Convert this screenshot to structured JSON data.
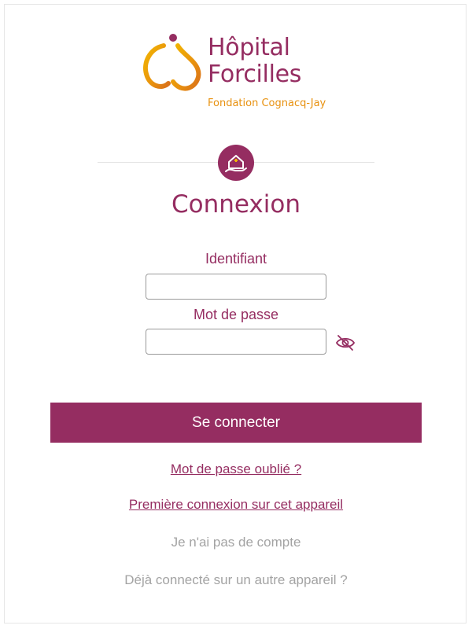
{
  "brand": {
    "name_line1": "Hôpital",
    "name_line2": "Forcilles",
    "subtitle": "Fondation Cognacq-Jay",
    "primary_color": "#952d61",
    "accent_color": "#e8910f"
  },
  "page_title": "Connexion",
  "form": {
    "identifiant_label": "Identifiant",
    "identifiant_value": "",
    "password_label": "Mot de passe",
    "password_value": "",
    "toggle_visibility_icon": "eye-off-icon",
    "submit_label": "Se connecter"
  },
  "links": {
    "forgot_password": "Mot de passe oublié ?",
    "first_connection": "Première connexion sur cet appareil",
    "no_account": "Je n'ai pas de compte",
    "already_connected": "Déjà connecté sur un autre appareil ?"
  },
  "divider_icon": "home-care-icon"
}
